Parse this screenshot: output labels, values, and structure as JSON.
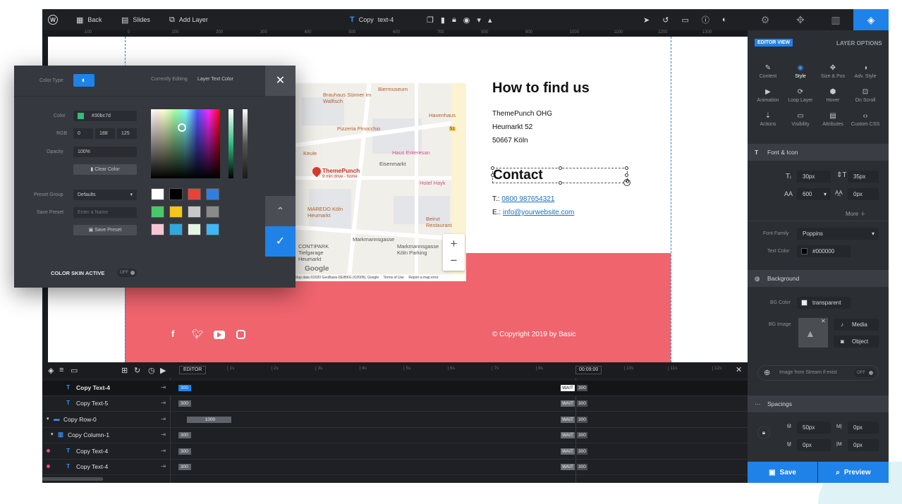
{
  "topbar": {
    "back": "Back",
    "slides": "Slides",
    "add_layer": "Add Layer",
    "copy": "Copy",
    "layer_name": "text-4"
  },
  "ruler": {
    "ticks": [
      "-100",
      "0",
      "100",
      "200",
      "300",
      "400",
      "500",
      "600",
      "700",
      "800",
      "900",
      "1000",
      "1100",
      "1200",
      "1300"
    ]
  },
  "content": {
    "heading": "How to find us",
    "address_lines": [
      "ThemePunch OHG",
      "Heumarkt 52",
      "50667 Köln"
    ],
    "contact_title": "Contact",
    "phone_label": "T.:",
    "phone": "0800 987654321",
    "email_label": "E.:",
    "email": "info@yourwebsite.com",
    "copyright": "© Copyright 2019 by Basic"
  },
  "map": {
    "labels": [
      "Biermuseum",
      "Brauhaus Sünner im Walfisch",
      "Haxenhaus",
      "Pizzeria Pinocchio",
      "Keule",
      "Eisenmarkt",
      "Haus Enteresan",
      "ThemePunch",
      "9 min drive - home",
      "Hotel Hayk",
      "MAREDO Köln Heumarkt",
      "Beirut Restaurant",
      "Markmannsgasse",
      "CONTIPARK Tiefgarage Heumarkt",
      "Markmannsgasse Köln Parking",
      "51"
    ],
    "google": "Google",
    "attribution": "Map data ©2020 GeoBasis-DE/BKG (©2009), Google",
    "terms": "Terms of Use",
    "report": "Report a map error",
    "zoom_in": "+",
    "zoom_out": "−"
  },
  "picker": {
    "color_type": "Color Type",
    "currently_editing": "Currently Editing",
    "editing_target": "Layer Text Color",
    "color_label": "Color",
    "color_value": "#30bc7d",
    "rgb_label": "RGB",
    "rgb": [
      "0",
      "188",
      "125"
    ],
    "opacity_label": "Opacity",
    "opacity": "100%",
    "clear": "Clear Color",
    "preset_group_label": "Preset Group",
    "preset_group": "Defaults",
    "save_preset_label": "Save Preset",
    "save_placeholder": "Enter a Name",
    "save_button": "Save Preset",
    "skin": "COLOR SKIN ACTIVE",
    "skin_state": "OFF",
    "swatches": [
      "#ffffff",
      "#000000",
      "#e8433a",
      "#2f7fe0",
      "#47c96a",
      "#f5c518",
      "#c8c8c8",
      "#8a8a8a",
      "#f7c6d4",
      "#2fa8e0",
      "#e4f3e4",
      "#3fb6f5"
    ]
  },
  "timeline": {
    "editor_label": "EDITOR",
    "end_time": "00:09:00",
    "ticks": [
      "1s",
      "2s",
      "3s",
      "4s",
      "5s",
      "6s",
      "7s",
      "8s",
      "9s",
      "10s",
      "11s",
      "12s"
    ],
    "rows": [
      {
        "name": "Copy Text-4",
        "start": "300",
        "wait": "WAIT",
        "end": "300"
      },
      {
        "name": "Copy Text-5",
        "start": "300",
        "wait": "WAIT",
        "end": "300"
      },
      {
        "name": "Copy Row-0",
        "start": "1000",
        "wait": "WAIT",
        "end": "300"
      },
      {
        "name": "Copy Column-1",
        "start": "300",
        "wait": "WAIT",
        "end": "300"
      },
      {
        "name": "Copy Text-4",
        "start": "300",
        "wait": "WAIT",
        "end": "300"
      },
      {
        "name": "Copy Text-4",
        "start": "300",
        "wait": "WAIT",
        "end": "300"
      }
    ]
  },
  "panel": {
    "editor_view": "EDITOR VIEW",
    "layer_options": "LAYER OPTIONS",
    "options": [
      "Content",
      "Style",
      "Size & Pos",
      "Adv. Style",
      "Animation",
      "Loop Layer",
      "Hover",
      "On Scroll",
      "Actions",
      "Visibility",
      "Attributes",
      "Custom CSS"
    ],
    "font_section": "Font & Icon",
    "font_size": "30px",
    "line_height": "35px",
    "font_weight": "600",
    "letter_spacing": "0px",
    "more": "More",
    "font_family_label": "Font Family",
    "font_family": "Poppins",
    "text_color_label": "Text Color",
    "text_color": "#000000",
    "bg_section": "Background",
    "bg_color_label": "BG Color",
    "bg_color": "transparent",
    "bg_image_label": "BG Image",
    "media": "Media",
    "object": "Object",
    "stream_label": "Image from Stream if exist",
    "stream_state": "OFF",
    "spacing_section": "Spacings",
    "spacing": [
      "50px",
      "0px",
      "0px",
      "0px"
    ],
    "save": "Save",
    "preview": "Preview"
  }
}
